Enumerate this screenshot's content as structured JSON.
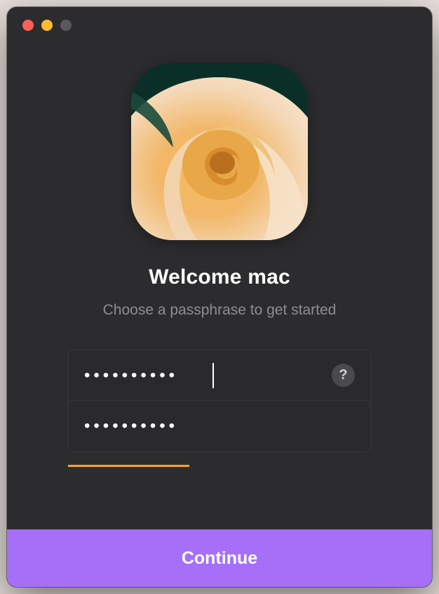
{
  "window": {
    "traffic_lights": {
      "close": true,
      "minimize": true,
      "maximize_disabled": true
    }
  },
  "avatar": {
    "icon_name": "rose-avatar"
  },
  "heading": {
    "title": "Welcome mac",
    "subtitle": "Choose a passphrase to get started"
  },
  "form": {
    "passphrase": {
      "value": "●●●●●●●●●●",
      "help_label": "?"
    },
    "confirm": {
      "value": "●●●●●●●●●●"
    },
    "strength_percent": 40,
    "strength_color": "#f5a623"
  },
  "actions": {
    "continue_label": "Continue"
  },
  "colors": {
    "accent": "#a56ff8",
    "bg": "#2c2c2e"
  }
}
